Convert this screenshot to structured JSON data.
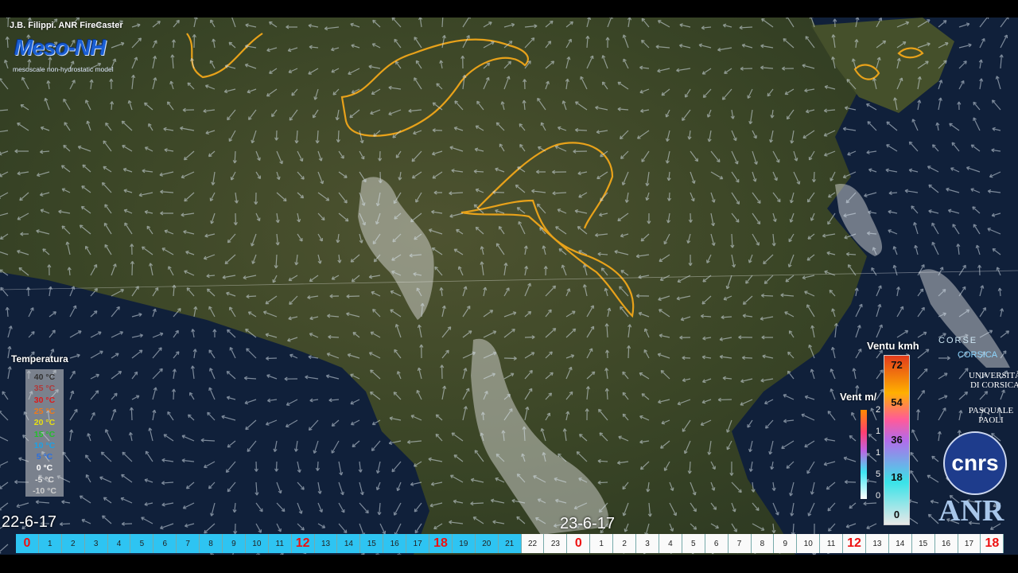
{
  "credit": "J.B. Filippi. ANR FireCaster",
  "model_logo": {
    "name": "Meso-NH",
    "subtitle": "mesoscale non-hydrostatic model"
  },
  "temperature_legend": {
    "title": "Temperatura",
    "entries": [
      {
        "label": "40 °C",
        "color": "#333333"
      },
      {
        "label": "35 °C",
        "color": "#b03a3a"
      },
      {
        "label": "30 °C",
        "color": "#e01818"
      },
      {
        "label": "25 °C",
        "color": "#f07a1a"
      },
      {
        "label": "20 °C",
        "color": "#e8e010"
      },
      {
        "label": "15 °C",
        "color": "#22c02a"
      },
      {
        "label": "10 °C",
        "color": "#1aa2e8"
      },
      {
        "label": "5 °C",
        "color": "#2a6fe0"
      },
      {
        "label": "0 °C",
        "color": "#ffffff"
      },
      {
        "label": "-5 °C",
        "color": "#e0e0e0"
      },
      {
        "label": "-10 °C",
        "color": "#cfcfcf"
      }
    ]
  },
  "wind_kmh_legend": {
    "title": "Ventu kmh",
    "labels": [
      "72",
      "54",
      "36",
      "18",
      "0"
    ]
  },
  "wind_ms_legend": {
    "title": "Vent m/",
    "labels": [
      "2",
      "1",
      "1",
      "5",
      "0"
    ]
  },
  "dates": {
    "day1": "22-6-17",
    "day2": "23-6-17"
  },
  "timeline": {
    "day1_hours": [
      "0",
      "1",
      "2",
      "3",
      "4",
      "5",
      "6",
      "7",
      "8",
      "9",
      "10",
      "11",
      "12",
      "13",
      "14",
      "15",
      "16",
      "17",
      "18",
      "19",
      "20",
      "21"
    ],
    "day2_hours": [
      "22",
      "23",
      "0",
      "1",
      "2",
      "3",
      "4",
      "5",
      "6",
      "7",
      "8",
      "9",
      "10",
      "11",
      "12",
      "13",
      "14",
      "15",
      "16",
      "17",
      "18"
    ],
    "highlight_hours": [
      "0",
      "12",
      "18"
    ]
  },
  "logos": {
    "corse": "CORSE",
    "corsica": "CORSICA",
    "university": "UNIVERSITÀ DI CORSICA",
    "paoli": "PASQUALE PAOLI",
    "cnrs": "cnrs",
    "anr": "ANR"
  },
  "colors": {
    "fire_perimeter": "#e8a21a",
    "sea": "#10203a",
    "land": "#3f4a2a",
    "timeline_day1": "#2ec4f2"
  }
}
